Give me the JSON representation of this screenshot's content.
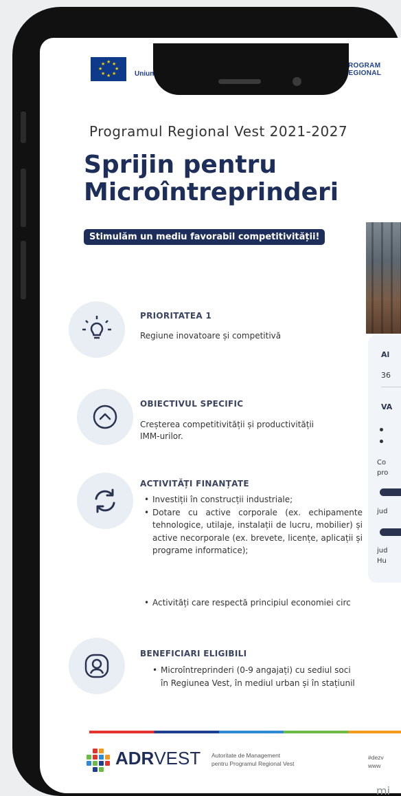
{
  "header": {
    "eu_text_line2": "Uniunea Europeană",
    "program_logo_text": [
      "PROGRAM",
      "REGIONAL"
    ]
  },
  "poster": {
    "program_subtitle": "Programul Regional Vest 2021-2027",
    "title_line1": "Sprijin pentru",
    "title_line2": "Microîntreprinderi",
    "tagline": "Stimulăm un mediu favorabil competitivității!"
  },
  "sections": {
    "priority": {
      "title": "PRIORITATEA 1",
      "text": "Regiune inovatoare și competitivă"
    },
    "objective": {
      "title": "OBIECTIVUL SPECIFIC",
      "text_line1": "Creșterea competitivității și productivității",
      "text_line2": "IMM-urilor."
    },
    "activities": {
      "title": "ACTIVITĂȚI FINANȚATE",
      "items": [
        "Investiții în construcții industriale;",
        "Dotare cu active corporale (ex. echipamente tehnologice, utilaje, instalații de lucru, mobilier) și active necorporale (ex. brevete, licențe, aplicații și programe informatice);"
      ],
      "extra_item": "Activități care respectă principiul economiei circ"
    },
    "beneficiaries": {
      "title": "BENEFICIARI ELIGIBILI",
      "text_line1": "Microîntreprinderi (0-9 angajați) cu sediul soci",
      "text_line2": "în Regiunea Vest, în mediul urban și în stațiunil"
    }
  },
  "side_card": {
    "frag_al": "Al",
    "frag_36": "36",
    "frag_va": "VA",
    "frag_co": "Co",
    "frag_pro": "pro",
    "frag_jud1": "jud",
    "frag_jud2": "jud",
    "frag_hu": "Hu"
  },
  "footer": {
    "adr_bold": "ADR",
    "adr_light": "VEST",
    "adr_sub_line1": "Autoritate de Management",
    "adr_sub_line2": "pentru Programul Regional Vest",
    "hash_line1": "#dezv",
    "hash_line2": "www",
    "corner_text": "mi"
  },
  "colors": {
    "navy": "#1d2e5a",
    "accent_red": "#e2332d",
    "accent_orange": "#f19a1d",
    "accent_blue": "#2f8ad6",
    "accent_green": "#6dbb45"
  },
  "icons": [
    "lightbulb-icon",
    "chevron-up-icon",
    "refresh-icon",
    "user-icon"
  ]
}
